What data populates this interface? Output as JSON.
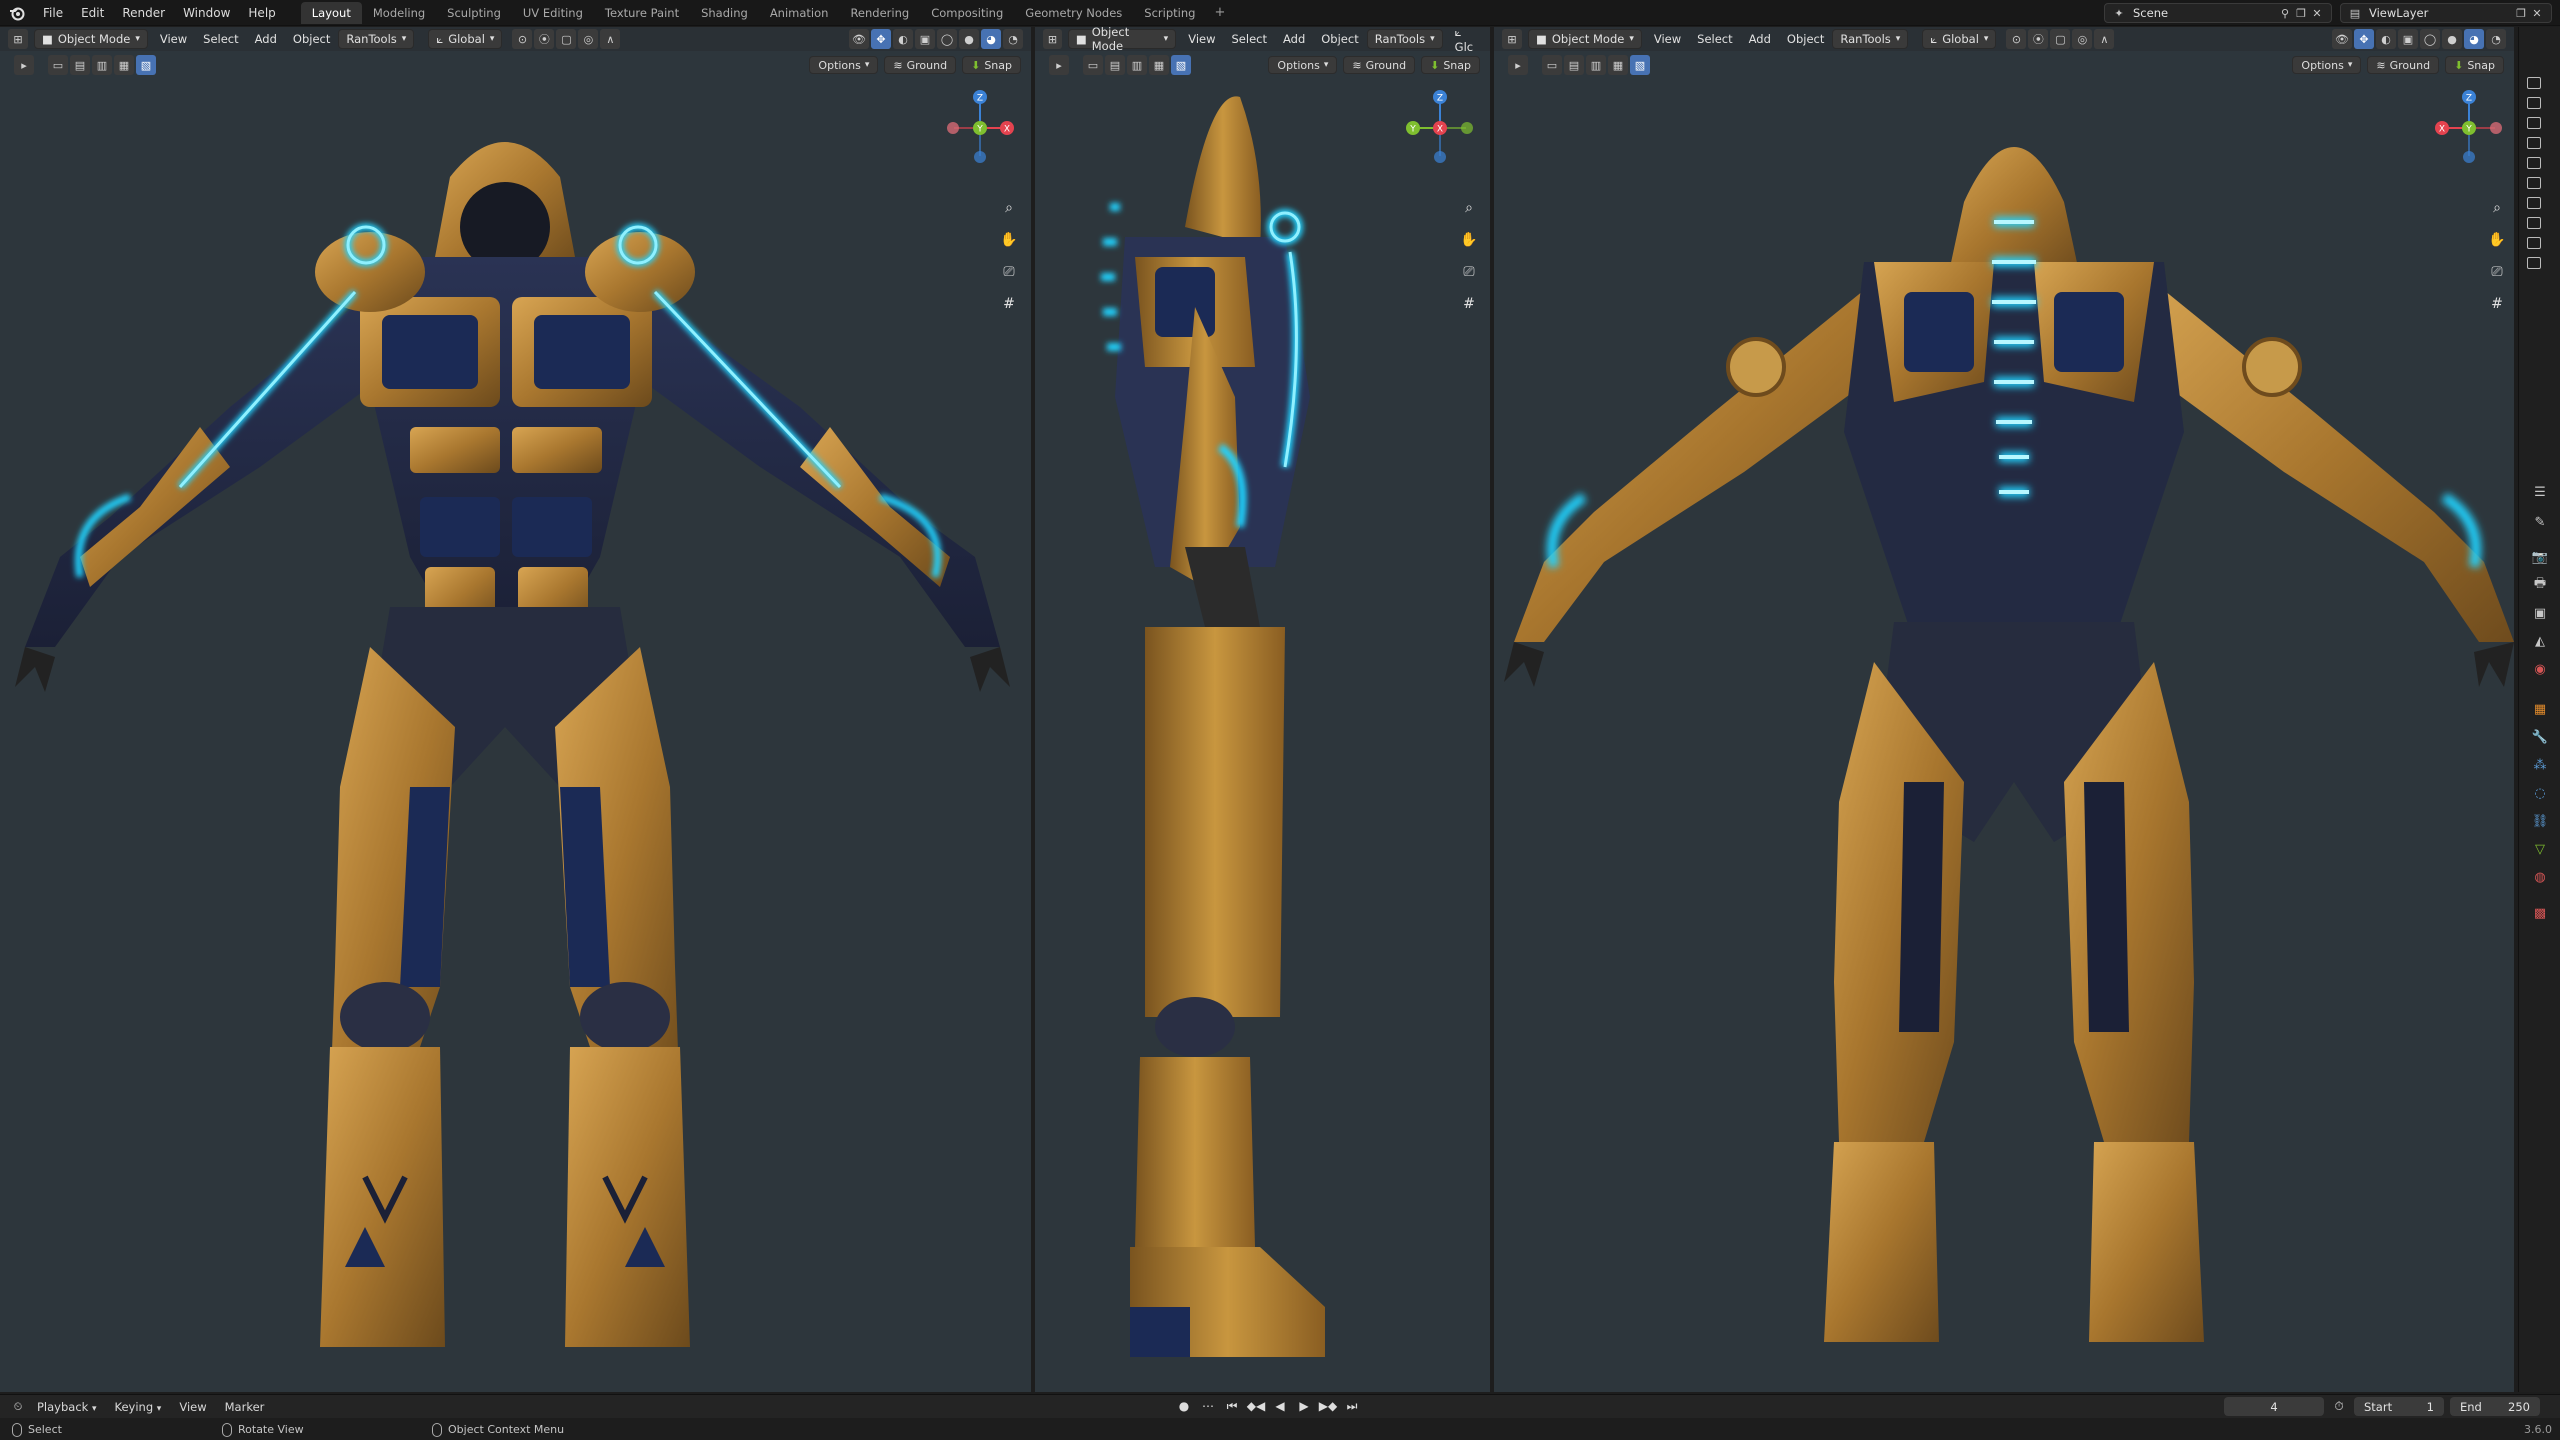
{
  "menu": [
    "File",
    "Edit",
    "Render",
    "Window",
    "Help"
  ],
  "workspaces": [
    "Layout",
    "Modeling",
    "Sculpting",
    "UV Editing",
    "Texture Paint",
    "Shading",
    "Animation",
    "Rendering",
    "Compositing",
    "Geometry Nodes",
    "Scripting"
  ],
  "active_workspace": "Layout",
  "add_workspace": "+",
  "scene_name": "Scene",
  "view_layer": "ViewLayer",
  "viewports": {
    "left": {
      "mode": "Object Mode",
      "menus": [
        "View",
        "Select",
        "Add",
        "Object",
        "RanTools"
      ],
      "orientation": "Global",
      "options": "Options",
      "ground": "Ground",
      "snap": "Snap"
    },
    "middle": {
      "mode": "Object Mode",
      "menus": [
        "View",
        "Select",
        "Add",
        "Object",
        "RanTools"
      ],
      "orientation": "Glc",
      "options": "Options",
      "ground": "Ground",
      "snap": "Snap"
    },
    "right": {
      "mode": "Object Mode",
      "menus": [
        "View",
        "Select",
        "Add",
        "Object",
        "RanTools"
      ],
      "orientation": "Global",
      "options": "Options",
      "ground": "Ground",
      "snap": "Snap"
    }
  },
  "gizmo_labels": {
    "z": "Z",
    "y": "Y",
    "x": "X"
  },
  "colors": {
    "viewport_bg": "#2d363c",
    "gold": "#b98a3e",
    "glow": "#23d3ff",
    "accent_blue": "#4772b3",
    "axis_x": "#e4434f",
    "axis_y": "#7fbf2f",
    "axis_z": "#3b82d6"
  },
  "timeline": {
    "menus": [
      "Playback",
      "Keying",
      "View",
      "Marker"
    ],
    "current_frame": "4",
    "start_label": "Start",
    "start_value": "1",
    "end_label": "End",
    "end_value": "250"
  },
  "status": {
    "select": "Select",
    "rotate": "Rotate View",
    "context_menu": "Object Context Menu",
    "version": "3.6.0"
  }
}
